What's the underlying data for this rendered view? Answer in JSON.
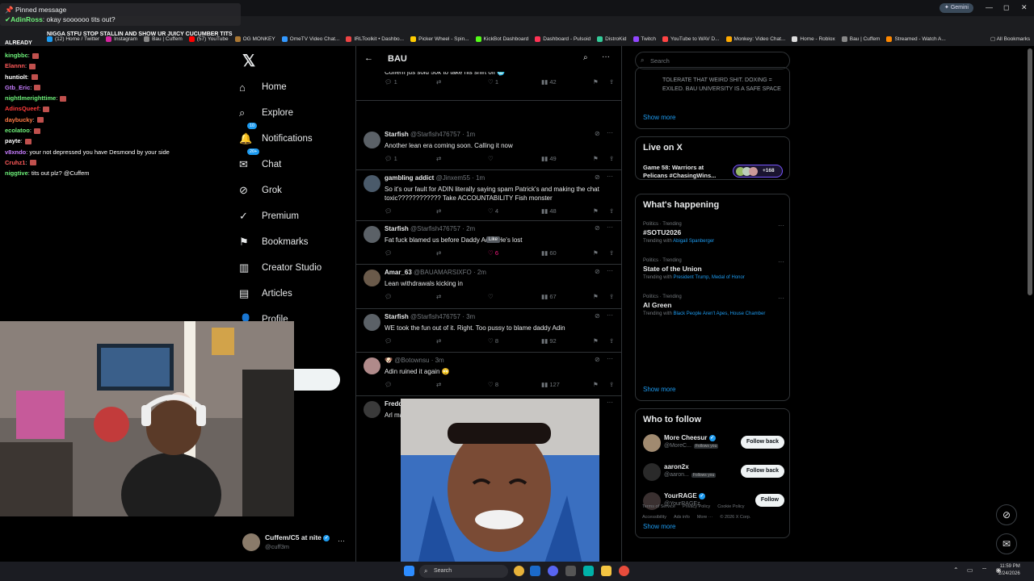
{
  "browser": {
    "assistant_label": "Gemini",
    "bookmarks": [
      {
        "label": "(12) Home / Twitter",
        "color": "#1d9bf0"
      },
      {
        "label": "Instagram",
        "color": "#d6249f"
      },
      {
        "label": "Bau | Cuffem",
        "color": "#888888"
      },
      {
        "label": "(57) YouTube",
        "color": "#ff0000"
      },
      {
        "label": "OG MONKEY",
        "color": "#aa7733"
      },
      {
        "label": "OmeTV Video Chat...",
        "color": "#3399ff"
      },
      {
        "label": "IRLToolkit • Dashbo...",
        "color": "#ee4444"
      },
      {
        "label": "Picker Wheel - Spin...",
        "color": "#ffcc00"
      },
      {
        "label": "KickBot Dashboard",
        "color": "#53fc18"
      },
      {
        "label": "Dashboard - Pulsoid",
        "color": "#ff3355"
      },
      {
        "label": "DistroKid",
        "color": "#33cc99"
      },
      {
        "label": "Twitch",
        "color": "#9146ff"
      },
      {
        "label": "YouTube to WAV D...",
        "color": "#ff4444"
      },
      {
        "label": "Monkey: Video Chat...",
        "color": "#ffaa00"
      },
      {
        "label": "Home - Roblox",
        "color": "#dddddd"
      },
      {
        "label": "Bau | Cuffem",
        "color": "#888888"
      },
      {
        "label": "Streamed - Watch A...",
        "color": "#ff8800"
      }
    ],
    "all_bookmarks": "All Bookmarks"
  },
  "chat": {
    "pinned_title": "Pinned message",
    "pinned_user": "AdinRoss",
    "pinned_text": "okay soooooo tits out?",
    "banner": "NIGGA STFU STOP STALLIN AND SHOW UR JUICY CUCUMBER TITS",
    "already": "ALREADY",
    "messages": [
      {
        "user": "kingbbc",
        "text": "",
        "color": "#6ef27a"
      },
      {
        "user": "Elannn",
        "text": "",
        "color": "#ff5a5a"
      },
      {
        "user": "huntiolt",
        "text": "",
        "color": "#ffffff"
      },
      {
        "user": "Gtb_Eric",
        "text": "",
        "color": "#c77dff"
      },
      {
        "user": "nightlmerighttime",
        "text": "",
        "color": "#6ef27a"
      },
      {
        "user": "AdinsQueef",
        "text": "",
        "color": "#ff3b3b"
      },
      {
        "user": "daybucky",
        "text": "",
        "color": "#ff7a45"
      },
      {
        "user": "ecolatoo",
        "text": "",
        "color": "#6ef27a"
      },
      {
        "user": "payte",
        "text": "",
        "color": "#ffffff"
      },
      {
        "user": "v8xndo",
        "text": "your not depressed you have Desmond by your side",
        "color": "#c77dff"
      },
      {
        "user": "Cruhz1",
        "text": "",
        "color": "#ff5a5a"
      },
      {
        "user": "niggtive",
        "text": "tits out plz? @Cuffem",
        "color": "#6ef27a"
      }
    ]
  },
  "nav": {
    "items": [
      {
        "label": "Home",
        "icon": "⌂"
      },
      {
        "label": "Explore",
        "icon": "⌕"
      },
      {
        "label": "Notifications",
        "icon": "🔔"
      },
      {
        "label": "Chat",
        "icon": "✉"
      },
      {
        "label": "Grok",
        "icon": "⊘"
      },
      {
        "label": "Premium",
        "icon": "✓"
      },
      {
        "label": "Bookmarks",
        "icon": "⚑"
      },
      {
        "label": "Creator Studio",
        "icon": "▥"
      },
      {
        "label": "Articles",
        "icon": "▤"
      },
      {
        "label": "Profile",
        "icon": "👤"
      }
    ],
    "notif_badge": "10",
    "chat_badge": "20+",
    "account_name": "Cuffem/C5 at nite",
    "account_handle": "@cuff3m"
  },
  "main": {
    "title": "BAU",
    "tweets": [
      {
        "name": "",
        "handle": "",
        "time": "",
        "text": "Cuffem jus sold 50k to take his shirt off 🥶",
        "replies": "1",
        "likes": "1",
        "views": "42"
      },
      {
        "name": "Starfish",
        "handle": "@Starfish476757",
        "time": "· 1m",
        "text": "Another lean era coming soon.  Calling it now",
        "replies": "1",
        "likes": "",
        "views": "49"
      },
      {
        "name": "gambling addict",
        "handle": "@Jinxem55",
        "time": "· 1m",
        "text": "So it's our fault for ADIN literally saying spam Patrick's and making the chat toxic???????????? Take ACCOUNTABILITY Fish monster",
        "replies": "",
        "likes": "4",
        "views": "48"
      },
      {
        "name": "Starfish",
        "handle": "@Starfish476757",
        "time": "· 2m",
        "text": "Fat fuck blamed us before Daddy Adin.  He's lost",
        "replies": "",
        "likes": "6",
        "views": "60"
      },
      {
        "name": "Amar_63",
        "handle": "@BAUAMARSIXFO",
        "time": "· 2m",
        "text": "Lean withdrawals kicking in",
        "replies": "",
        "likes": "",
        "views": "67"
      },
      {
        "name": "Starfish",
        "handle": "@Starfish476757",
        "time": "· 3m",
        "text": "WE took the fun out of it.  Right.  Too pussy to blame daddy Adin",
        "replies": "",
        "likes": "8",
        "views": "92"
      },
      {
        "name": "🐶",
        "handle": "@Botownsu",
        "time": "· 3m",
        "text": "Adin ruined it again 🙄",
        "replies": "",
        "likes": "8",
        "views": "127"
      },
      {
        "name": "Freddy",
        "handle": "@FreddyBearThug",
        "time": "· 3m",
        "text": "Arl mad rn",
        "replies": "",
        "likes": "",
        "views": ""
      }
    ],
    "tooltip": "Like"
  },
  "right": {
    "search_placeholder": "Search",
    "top_card_text": "TOLERATE THAT WEIRD SHIT. DOXING = EXILED. BAU UNIVERSITY IS A SAFE SPACE",
    "show_more": "Show more",
    "live_title": "Live on X",
    "live_event": "Game 58: Warriors at Pelicans #ChasingWins...",
    "live_count": "+168",
    "happening_title": "What's happening",
    "trends": [
      {
        "cat": "Politics · Trending",
        "name": "#SOTU2026",
        "with_label": "Trending with",
        "with": "Abigail Spanberger"
      },
      {
        "cat": "Politics · Trending",
        "name": "State of the Union",
        "with_label": "Trending with",
        "with": "President Trump, Medal of Honor"
      },
      {
        "cat": "Politics · Trending",
        "name": "Al Green",
        "with_label": "Trending with",
        "with": "Black People Aren't Apes, House Chamber"
      }
    ],
    "wtf_title": "Who to follow",
    "follow": [
      {
        "name": "More Cheesur",
        "handle": "@MoreC...",
        "tag": "Follows you",
        "btn": "Follow back",
        "verified": true
      },
      {
        "name": "aaron2x",
        "handle": "@aaron...",
        "tag": "Follows you",
        "btn": "Follow back",
        "verified": false
      },
      {
        "name": "YourRAGE",
        "handle": "@YourRAGEz",
        "tag": "",
        "btn": "Follow",
        "verified": true
      }
    ],
    "footer": [
      "Terms of Service",
      "Privacy Policy",
      "Cookie Policy",
      "Accessibility",
      "Ads info",
      "More ···",
      "© 2026 X Corp."
    ]
  },
  "taskbar": {
    "search": "Search",
    "time": "11:59 PM",
    "date": "2/24/2026"
  }
}
